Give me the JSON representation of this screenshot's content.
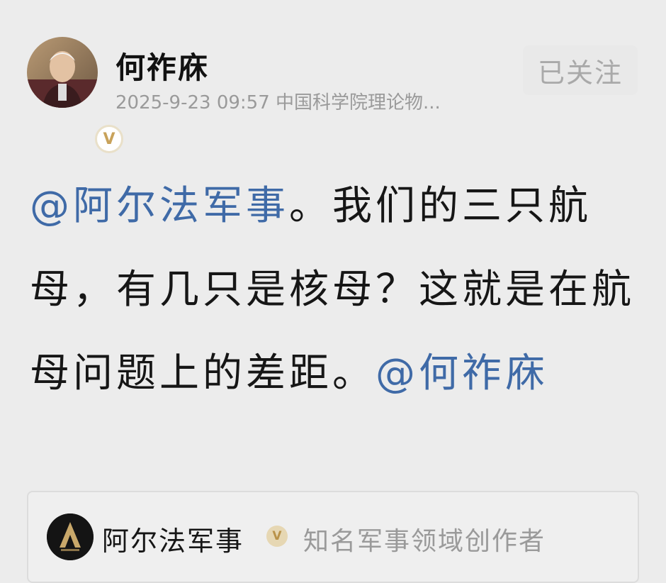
{
  "author": {
    "name": "何祚庥",
    "timestamp": "2025-9-23 09:57",
    "description": "中国科学院理论物...",
    "avatar_icon": "user-avatar-photo",
    "verified_icon": "verified-badge-icon",
    "verified_mark": "V"
  },
  "follow_button": {
    "label": "已关注"
  },
  "post": {
    "mention_1": "@阿尔法军事",
    "text": "。我们的三只航母，有几只是核母？这就是在航母问题上的差距。",
    "mention_2": "@何祚庥"
  },
  "mentioned_card": {
    "name": "阿尔法军事",
    "description": "知名军事领域创作者",
    "badge_mark": "V",
    "avatar_icon": "alpha-logo-icon"
  },
  "colors": {
    "mention": "#3f6aa7",
    "background": "#ececec",
    "badge_gold": "#c8a25a"
  }
}
